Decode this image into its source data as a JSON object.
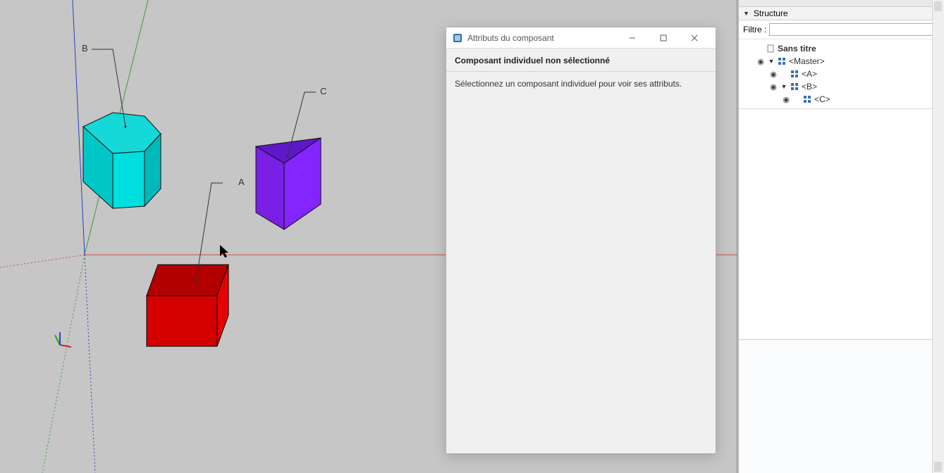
{
  "viewport": {
    "labels": {
      "A": "A",
      "B": "B",
      "C": "C"
    }
  },
  "dialog": {
    "title": "Attributs du composant",
    "subtitle": "Composant individuel non sélectionné",
    "body": "Sélectionnez un composant individuel pour voir ses attributs."
  },
  "structure_panel": {
    "header": "Structure",
    "filter_label": "Filtre :",
    "filter_value": "",
    "root": "Sans titre",
    "items": [
      {
        "name": "<Master>",
        "depth": 1,
        "expandable": true,
        "expanded": true
      },
      {
        "name": "<A>",
        "depth": 2,
        "expandable": false
      },
      {
        "name": "<B>",
        "depth": 2,
        "expandable": true,
        "expanded": true
      },
      {
        "name": "<C>",
        "depth": 3,
        "expandable": false
      }
    ]
  }
}
